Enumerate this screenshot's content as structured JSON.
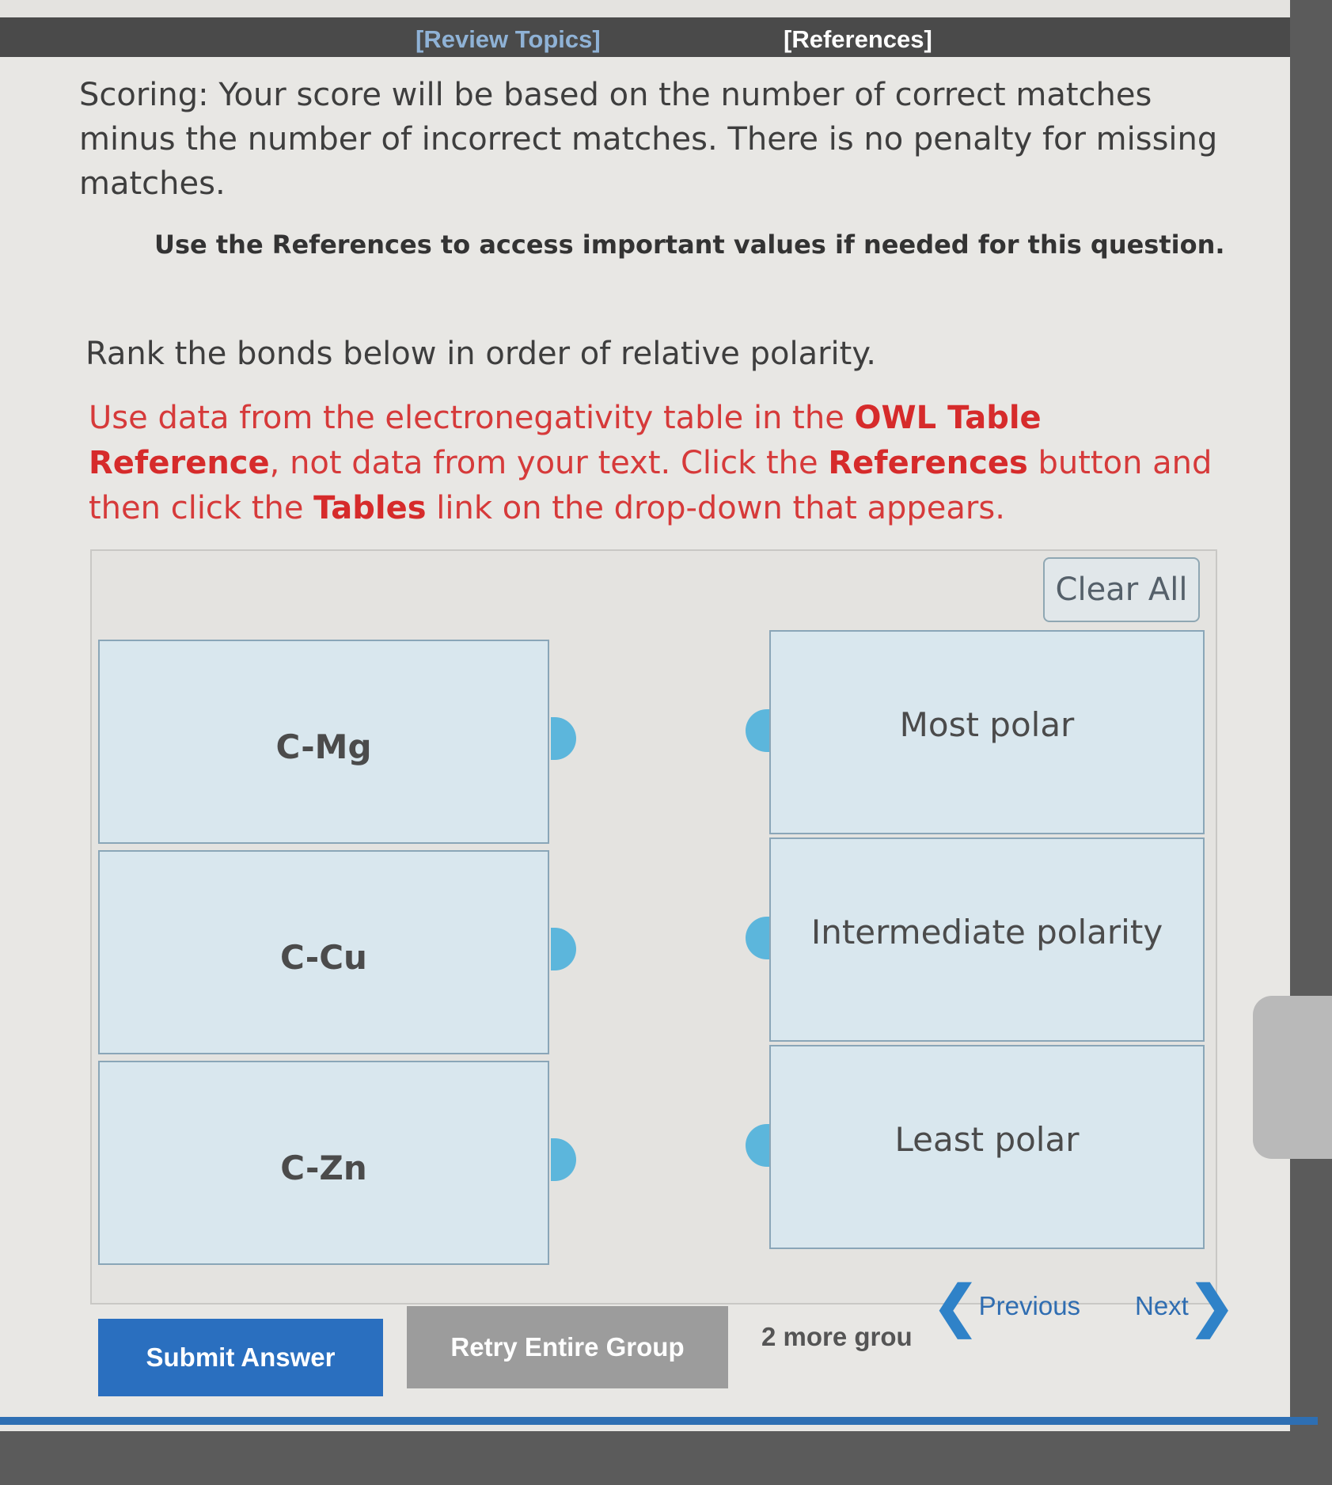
{
  "header": {
    "review_topics": "[Review Topics]",
    "references": "[References]"
  },
  "scoring": "Scoring: Your score will be based on the number of correct matches minus the number of incorrect matches. There is no penalty for missing matches.",
  "references_note": "Use the References to access important values if needed for this question.",
  "question": "Rank the bonds below in order of relative polarity.",
  "instructions": {
    "part1": "Use data from the electronegativity table in the ",
    "owl_table_reference": "OWL Table Reference",
    "part2": ", not data from your text. Click the ",
    "references": "References",
    "part3": " button and then click the ",
    "tables": "Tables",
    "part4": " link on the drop-down that appears."
  },
  "matching": {
    "clear_all": "Clear All",
    "bonds": [
      "C-Mg",
      "C-Cu",
      "C-Zn"
    ],
    "targets": [
      "Most polar",
      "Intermediate polarity",
      "Least polar"
    ]
  },
  "footer": {
    "submit": "Submit Answer",
    "retry": "Retry Entire Group",
    "more_groups": "2 more grou",
    "previous": "Previous",
    "next": "Next"
  },
  "colors": {
    "link_blue": "#2f6db1",
    "warning_red": "#d63a3a",
    "card_bg": "#d9e7ee",
    "connector": "#5cb6dc"
  }
}
